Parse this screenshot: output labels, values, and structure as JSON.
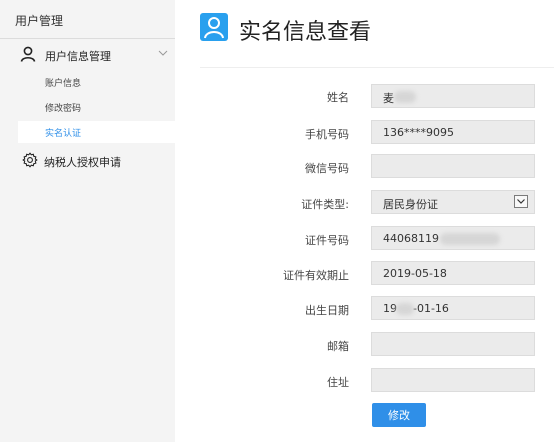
{
  "sidebar": {
    "title": "用户管理",
    "group": {
      "label": "用户信息管理",
      "icon": "user-icon",
      "expanded": true
    },
    "items": [
      {
        "label": "账户信息",
        "active": false
      },
      {
        "label": "修改密码",
        "active": false
      },
      {
        "label": "实名认证",
        "active": true
      }
    ],
    "tax": {
      "label": "纳税人授权申请",
      "icon": "gear-icon"
    }
  },
  "page": {
    "title": "实名信息查看",
    "icon": "user-icon"
  },
  "form": {
    "name": {
      "label": "姓名",
      "value": "麦"
    },
    "phone": {
      "label": "手机号码",
      "value": "136****9095"
    },
    "wechat": {
      "label": "微信号码",
      "value": ""
    },
    "id_type": {
      "label": "证件类型:",
      "value": "居民身份证"
    },
    "id_number": {
      "label": "证件号码",
      "value": "44068119"
    },
    "id_expiry": {
      "label": "证件有效期止",
      "value": "2019-05-18"
    },
    "birth": {
      "label": "出生日期",
      "value_prefix": "19",
      "value_suffix": "-01-16"
    },
    "email": {
      "label": "邮箱",
      "value": ""
    },
    "address": {
      "label": "住址",
      "value": ""
    }
  },
  "actions": {
    "modify_label": "修改"
  },
  "colors": {
    "accent": "#2f8fe8",
    "icon_blue": "#29a0ee",
    "sidebar_bg": "#f4f4f4",
    "field_bg": "#ebebeb"
  }
}
